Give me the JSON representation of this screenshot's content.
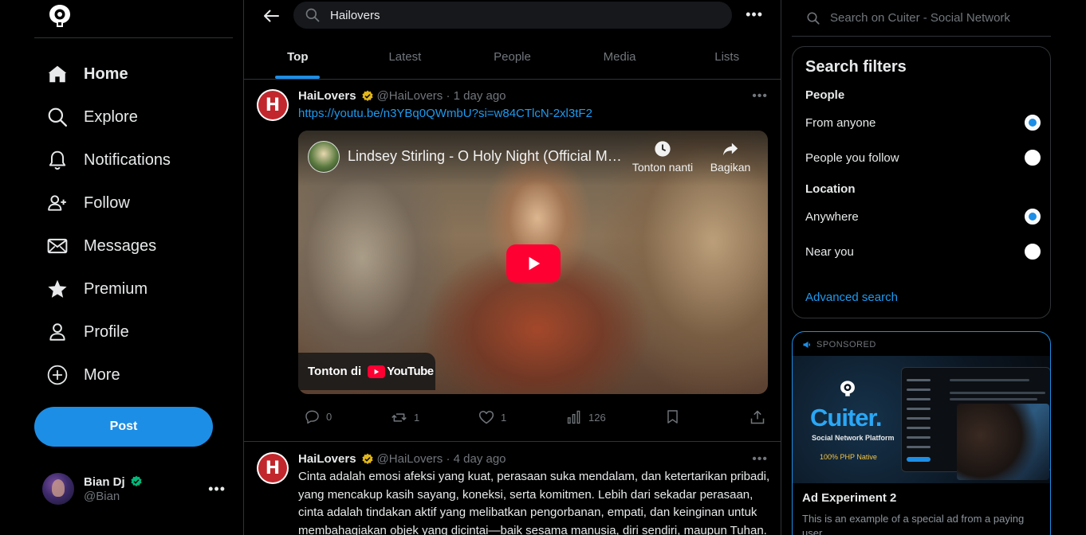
{
  "sidebar": {
    "items": [
      {
        "label": "Home",
        "icon": "home-icon"
      },
      {
        "label": "Explore",
        "icon": "search-icon"
      },
      {
        "label": "Notifications",
        "icon": "bell-icon"
      },
      {
        "label": "Follow",
        "icon": "person-add-icon"
      },
      {
        "label": "Messages",
        "icon": "envelope-icon"
      },
      {
        "label": "Premium",
        "icon": "star-icon"
      },
      {
        "label": "Profile",
        "icon": "person-icon"
      },
      {
        "label": "More",
        "icon": "plus-circle-icon"
      }
    ],
    "post_label": "Post",
    "user": {
      "name": "Bian Dj",
      "handle": "@Bian",
      "more": "•••"
    }
  },
  "search": {
    "query": "Hailovers",
    "more": "•••"
  },
  "tabs": [
    "Top",
    "Latest",
    "People",
    "Media",
    "Lists"
  ],
  "tweets": [
    {
      "name": "HaiLovers",
      "avatar_letter": "H",
      "meta": "@HaiLovers · 1 day ago",
      "link": "https://youtu.be/n3YBq0QWmbU?si=w84CTlcN-2xl3tF2",
      "video": {
        "title": "Lindsey Stirling - O Holy Night (Official Mu...",
        "watch_later": "Tonton nanti",
        "share": "Bagikan",
        "watch_on": "Tonton di",
        "platform": "YouTube"
      },
      "stats": {
        "replies": "0",
        "reposts": "1",
        "likes": "1",
        "views": "126"
      },
      "more": "•••"
    },
    {
      "name": "HaiLovers",
      "avatar_letter": "H",
      "meta": "@HaiLovers · 4 day ago",
      "text": "Cinta adalah emosi afeksi yang kuat, perasaan suka mendalam, dan ketertarikan pribadi, yang mencakup kasih sayang, koneksi, serta komitmen. Lebih dari sekadar perasaan, cinta adalah tindakan aktif yang melibatkan pengorbanan, empati, dan keinginan untuk membahagiakan objek yang dicintai—baik sesama manusia, diri sendiri, maupun Tuhan.",
      "more": "•••"
    }
  ],
  "right": {
    "search_placeholder": "Search on Cuiter - Social Network",
    "filters": {
      "title": "Search filters",
      "people_heading": "People",
      "people_options": [
        {
          "label": "From anyone",
          "selected": true
        },
        {
          "label": "People you follow",
          "selected": false
        }
      ],
      "location_heading": "Location",
      "location_options": [
        {
          "label": "Anywhere",
          "selected": true
        },
        {
          "label": "Near you",
          "selected": false
        }
      ],
      "advanced": "Advanced search"
    },
    "ad": {
      "sponsored": "SPONSORED",
      "brand": "Cuiter.",
      "tagline": "Social Network Platform",
      "native": "100% PHP Native",
      "title": "Ad Experiment 2",
      "body": "This is an example of a special ad from a paying user"
    }
  },
  "colors": {
    "accent": "#1d8ee6",
    "link": "#1d9bf0",
    "background": "#000000",
    "border": "#2f3336",
    "muted": "#71767b",
    "youtube_red": "#ff0033",
    "verified_gold": "#e2b719",
    "verified_green": "#00ba7c"
  }
}
